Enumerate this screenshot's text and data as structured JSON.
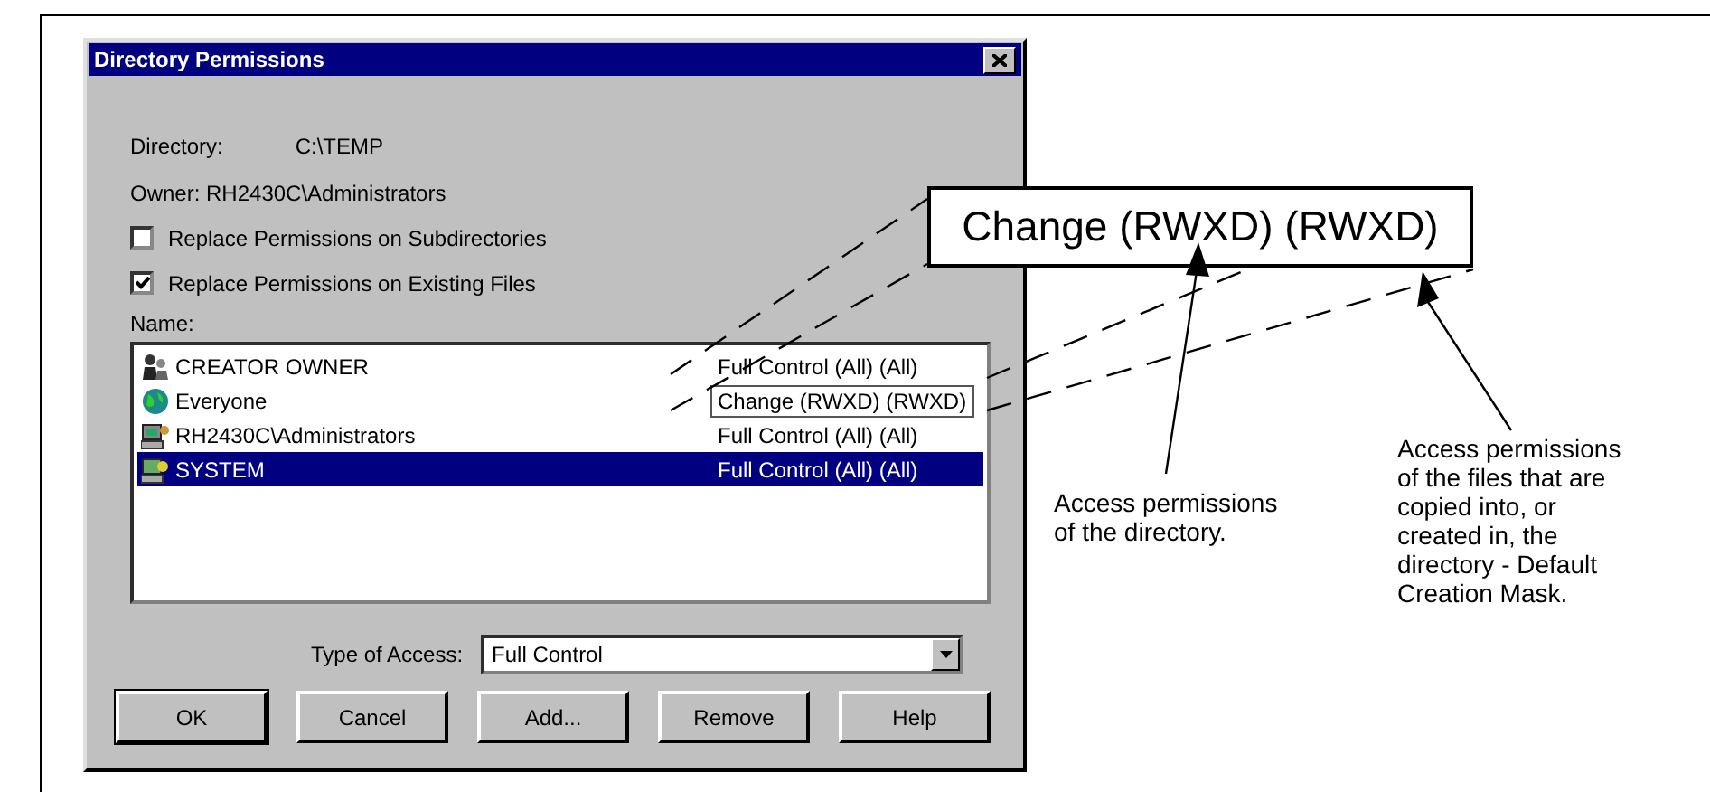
{
  "dialog": {
    "title": "Directory Permissions",
    "directory_label": "Directory:",
    "directory_value": "C:\\TEMP",
    "owner": "Owner: RH2430C\\Administrators",
    "checkboxes": [
      {
        "label": "Replace Permissions on Subdirectories",
        "checked": false
      },
      {
        "label": "Replace Permissions on Existing Files",
        "checked": true
      }
    ],
    "name_label": "Name:",
    "entries": [
      {
        "kind": "group",
        "name": "CREATOR OWNER",
        "access": "Full Control (All) (All)",
        "selected": false,
        "outlined": false
      },
      {
        "kind": "globe",
        "name": "Everyone",
        "access": "Change (RWXD) (RWXD)",
        "selected": false,
        "outlined": true
      },
      {
        "kind": "computer",
        "name": "RH2430C\\Administrators",
        "access": "Full Control (All) (All)",
        "selected": false,
        "outlined": false
      },
      {
        "kind": "system",
        "name": "SYSTEM",
        "access": "Full Control (All) (All)",
        "selected": true,
        "outlined": false
      }
    ],
    "access_label": "Type of Access:",
    "access_value": "Full Control",
    "buttons": [
      "OK",
      "Cancel",
      "Add...",
      "Remove",
      "Help"
    ]
  },
  "callout": {
    "text": "Change (RWXD) (RWXD)",
    "notes": [
      "Access permissions of the directory.",
      "Access permissions of the files that are copied into, or created in, the directory - Default Creation Mask."
    ]
  }
}
